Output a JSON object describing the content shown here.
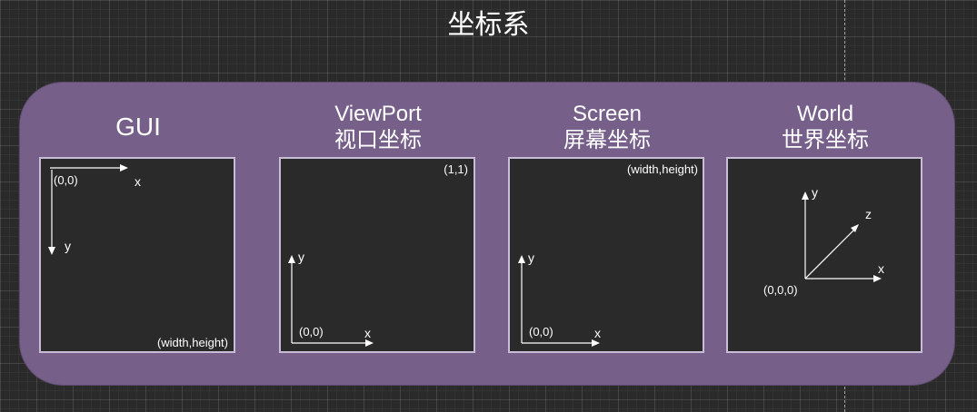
{
  "title": "坐标系",
  "colors": {
    "container": "#76608a",
    "panel": "#2a2a2a",
    "border": "#c9bcd6",
    "line": "#ffffff"
  },
  "panels": [
    {
      "title_line1": "GUI",
      "title_line2": "",
      "origin_label": "(0,0)",
      "corner_label": "(width,height)",
      "x_label": "x",
      "y_label": "y"
    },
    {
      "title_line1": "ViewPort",
      "title_line2": "视口坐标",
      "origin_label": "(0,0)",
      "corner_label": "(1,1)",
      "x_label": "x",
      "y_label": "y"
    },
    {
      "title_line1": "Screen",
      "title_line2": "屏幕坐标",
      "origin_label": "(0,0)",
      "corner_label": "(width,height)",
      "x_label": "x",
      "y_label": "y"
    },
    {
      "title_line1": "World",
      "title_line2": "世界坐标",
      "origin_label": "(0,0,0)",
      "x_label": "x",
      "y_label": "y",
      "z_label": "z"
    }
  ]
}
